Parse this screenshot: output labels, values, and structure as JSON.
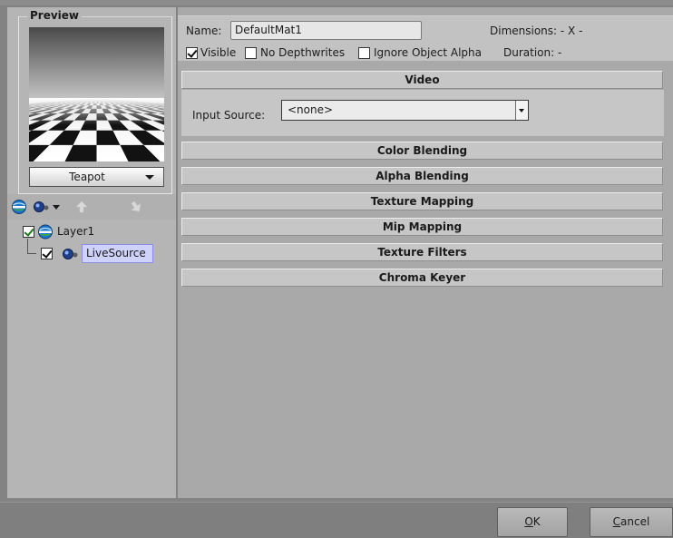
{
  "preview": {
    "title": "Preview",
    "geometry_select": {
      "value": "Teapot",
      "arrow_icon": "chevron-down-icon"
    }
  },
  "layer_toolbar": {
    "icons": [
      "add-layer-icon",
      "add-source-icon",
      "dropdown-arrow-icon",
      "move-up-icon",
      "move-down-icon"
    ]
  },
  "layers": {
    "items": [
      {
        "label": "Layer1",
        "checked": true,
        "icon": "layer-icon"
      },
      {
        "label": "LiveSource",
        "checked": true,
        "icon": "live-source-icon",
        "selected": true
      }
    ]
  },
  "material": {
    "name_label": "Name:",
    "name_value": "DefaultMat1",
    "dimensions_label": "Dimensions: - X -",
    "duration_label": "Duration: -",
    "visible_label": "Visible",
    "visible_checked": true,
    "no_depthwrites_label": "No Depthwrites",
    "no_depthwrites_checked": false,
    "ignore_alpha_label": "Ignore Object Alpha",
    "ignore_alpha_checked": false
  },
  "video": {
    "header": "Video",
    "input_source_label": "Input Source:",
    "input_source_value": "<none>"
  },
  "sections": [
    "Color Blending",
    "Alpha Blending",
    "Texture Mapping",
    "Mip Mapping",
    "Texture Filters",
    "Chroma Keyer"
  ],
  "dialog": {
    "ok_label": "OK",
    "ok_underline": "O",
    "ok_rest": "K",
    "cancel_label": "Cancel",
    "cancel_underline": "C",
    "cancel_rest": "ancel"
  },
  "colors": {
    "selection_bg": "#cfd3fb",
    "selection_border": "#8c8fe6",
    "checkbox_green": "#1c7a1c"
  }
}
